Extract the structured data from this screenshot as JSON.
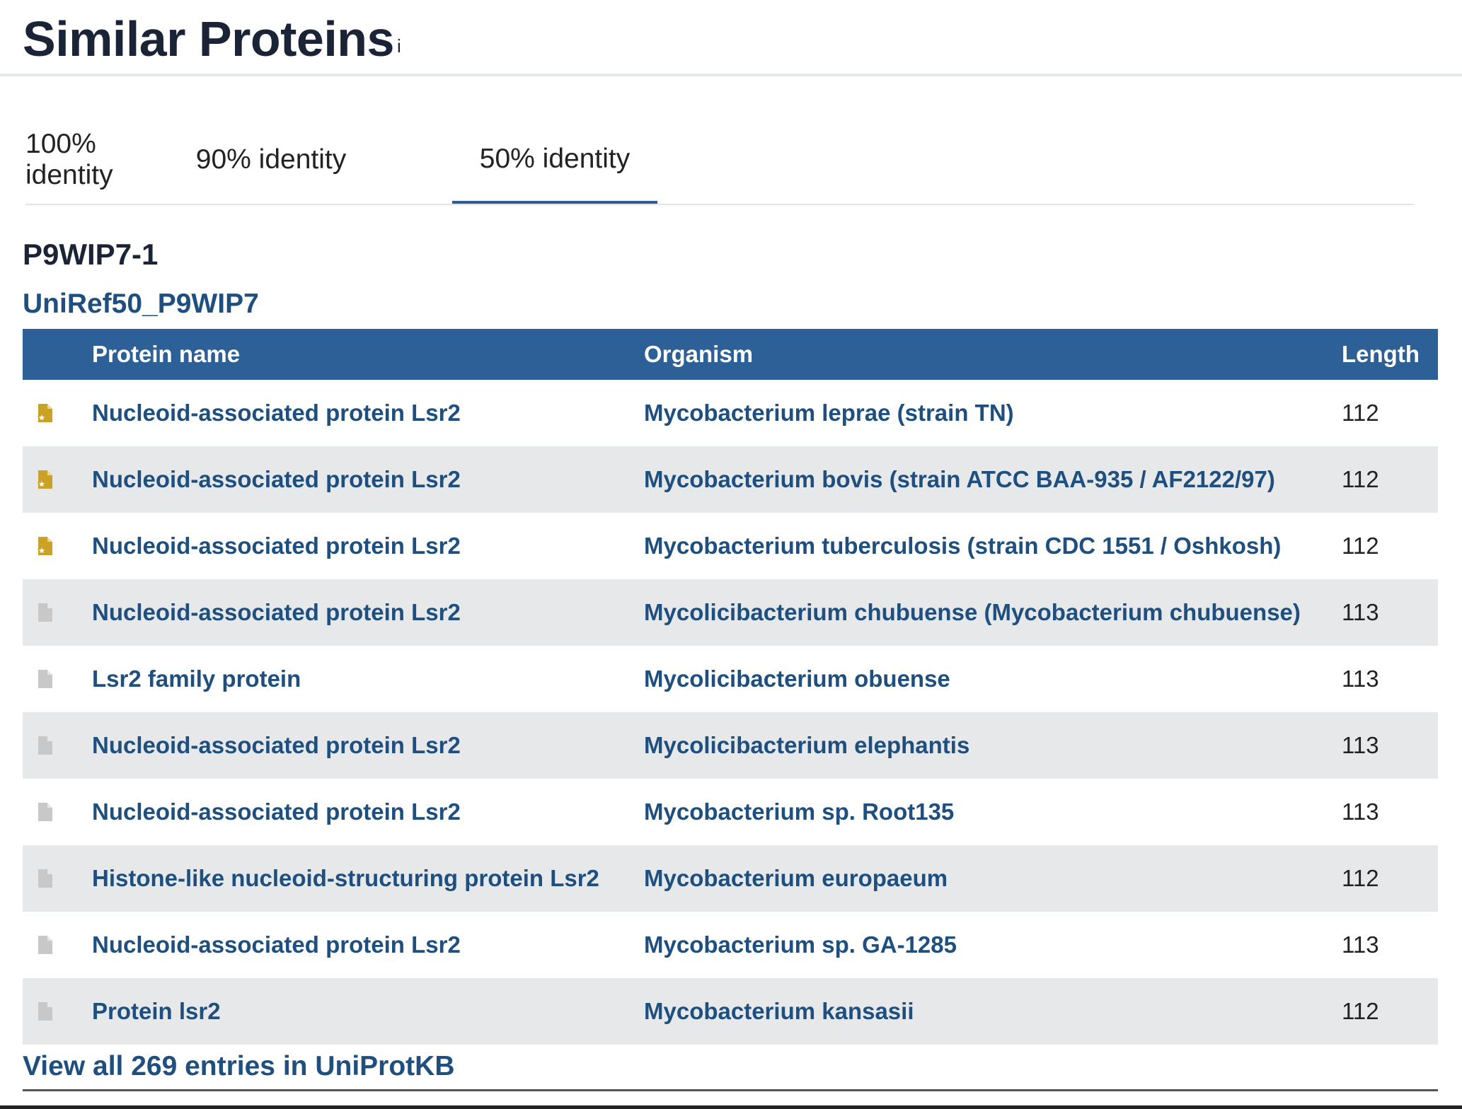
{
  "header": {
    "title": "Similar Proteins",
    "info_mark": "i"
  },
  "tabs": [
    {
      "label": "100% identity",
      "active": false
    },
    {
      "label": "90% identity",
      "active": false
    },
    {
      "label": "50% identity",
      "active": true
    }
  ],
  "cluster": {
    "id": "P9WIP7-1",
    "link": "UniRef50_P9WIP7"
  },
  "table": {
    "columns": [
      "Protein name",
      "Organism",
      "Length"
    ],
    "rows": [
      {
        "reviewed": true,
        "name": "Nucleoid-associated protein Lsr2",
        "organism": "Mycobacterium leprae (strain TN)",
        "length": "112"
      },
      {
        "reviewed": true,
        "name": "Nucleoid-associated protein Lsr2",
        "organism": "Mycobacterium bovis (strain ATCC BAA-935 / AF2122/97)",
        "length": "112"
      },
      {
        "reviewed": true,
        "name": "Nucleoid-associated protein Lsr2",
        "organism": "Mycobacterium tuberculosis (strain CDC 1551 / Oshkosh)",
        "length": "112"
      },
      {
        "reviewed": false,
        "name": "Nucleoid-associated protein Lsr2",
        "organism": "Mycolicibacterium chubuense (Mycobacterium chubuense)",
        "length": "113"
      },
      {
        "reviewed": false,
        "name": "Lsr2 family protein",
        "organism": "Mycolicibacterium obuense",
        "length": "113"
      },
      {
        "reviewed": false,
        "name": "Nucleoid-associated protein Lsr2",
        "organism": "Mycolicibacterium elephantis",
        "length": "113"
      },
      {
        "reviewed": false,
        "name": "Nucleoid-associated protein Lsr2",
        "organism": "Mycobacterium sp. Root135",
        "length": "113"
      },
      {
        "reviewed": false,
        "name": "Histone-like nucleoid-structuring protein Lsr2",
        "organism": "Mycobacterium europaeum",
        "length": "112"
      },
      {
        "reviewed": false,
        "name": "Nucleoid-associated protein Lsr2",
        "organism": "Mycobacterium sp. GA-1285",
        "length": "113"
      },
      {
        "reviewed": false,
        "name": "Protein lsr2",
        "organism": "Mycobacterium kansasii",
        "length": "112"
      }
    ]
  },
  "footer": {
    "view_all": "View all 269 entries in UniProtKB"
  },
  "colors": {
    "header_bg": "#2d6096",
    "link": "#1f4f7f",
    "reviewed_icon": "#c9a227",
    "unreviewed_icon": "#c8c8c8",
    "stripe": "#e6e8ea"
  },
  "icons": {
    "reviewed": "reviewed-doc-icon",
    "unreviewed": "unreviewed-doc-icon"
  }
}
